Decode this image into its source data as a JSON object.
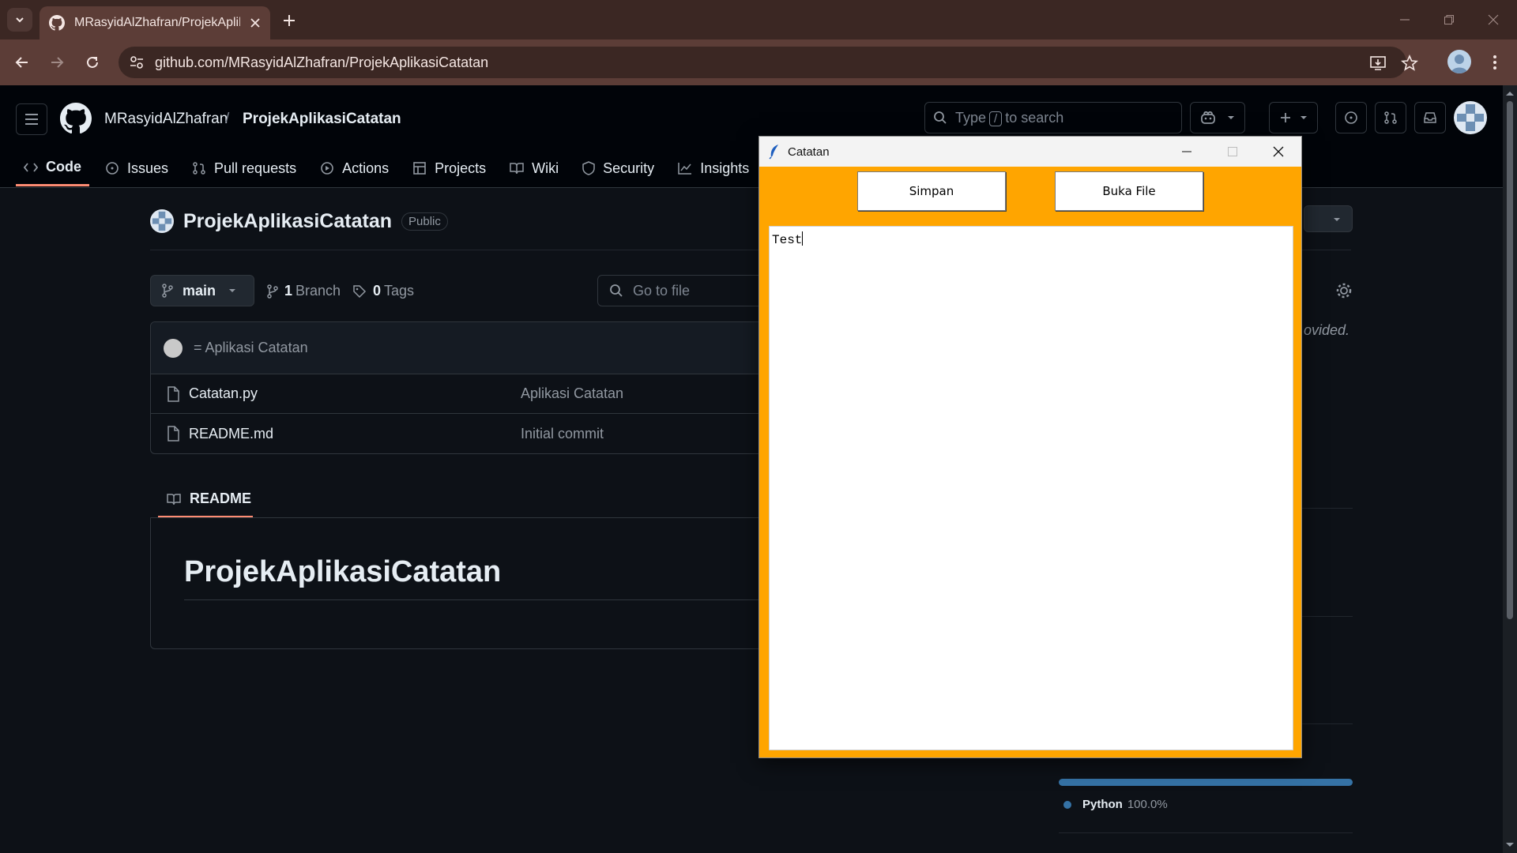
{
  "browser": {
    "tab_title": "MRasyidAlZhafran/ProjekAplikasiCatatan",
    "url": "github.com/MRasyidAlZhafran/ProjekAplikasiCatatan"
  },
  "github": {
    "owner": "MRasyidAlZhafran",
    "separator": "/",
    "repo": "ProjekAplikasiCatatan",
    "search": {
      "prefix": "Type",
      "key": "/",
      "suffix": "to search"
    },
    "tabs": [
      {
        "label": "Code",
        "icon": "code-icon",
        "active": true
      },
      {
        "label": "Issues",
        "icon": "issue-icon"
      },
      {
        "label": "Pull requests",
        "icon": "pull-request-icon"
      },
      {
        "label": "Actions",
        "icon": "play-icon"
      },
      {
        "label": "Projects",
        "icon": "table-icon"
      },
      {
        "label": "Wiki",
        "icon": "book-icon"
      },
      {
        "label": "Security",
        "icon": "shield-icon"
      },
      {
        "label": "Insights",
        "icon": "graph-icon"
      }
    ]
  },
  "repo": {
    "name": "ProjekAplikasiCatatan",
    "visibility": "Public",
    "branch": "main",
    "branch_count": "1",
    "branch_label": "Branch",
    "tag_count": "0",
    "tag_label": "Tags",
    "goto_placeholder": "Go to file",
    "latest_commit": "= Aplikasi Catatan",
    "files": [
      {
        "name": "Catatan.py",
        "message": "Aplikasi Catatan"
      },
      {
        "name": "README.md",
        "message": "Initial commit"
      }
    ],
    "readme_tab": "README",
    "readme_heading": "ProjekAplikasiCatatan",
    "about_fragment": "ovided.",
    "language": {
      "name": "Python",
      "percent": "100.0%",
      "color": "#3572a5"
    }
  },
  "app": {
    "title": "Catatan",
    "buttons": {
      "save": "Simpan",
      "open": "Buka File"
    },
    "text_content": "Test",
    "background_color": "#ffa500"
  }
}
